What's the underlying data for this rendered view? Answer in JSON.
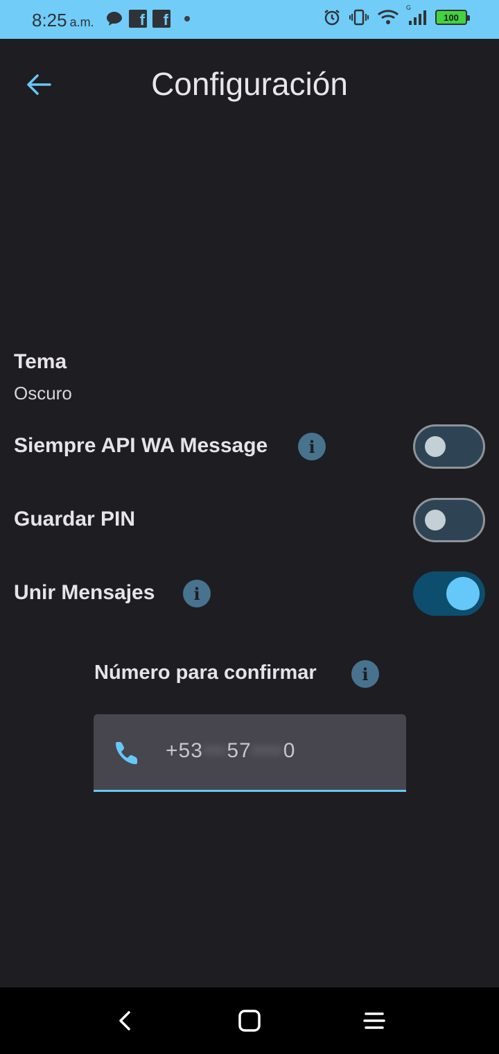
{
  "status_bar": {
    "time": "8:25",
    "ampm": "a.m.",
    "battery": "100",
    "icons_left": [
      "chat-bubble-icon",
      "facebook-icon",
      "facebook-icon",
      "dot"
    ],
    "icons_right": [
      "alarm-icon",
      "vibrate-icon",
      "wifi-icon",
      "signal-icon",
      "battery-icon"
    ],
    "network_letter": "G"
  },
  "appbar": {
    "title": "Configuración"
  },
  "settings": {
    "theme": {
      "label": "Tema",
      "value": "Oscuro"
    },
    "always_api": {
      "label": "Siempre API WA Message",
      "enabled": false
    },
    "save_pin": {
      "label": "Guardar PIN",
      "enabled": false
    },
    "join_messages": {
      "label": "Unir Mensajes",
      "enabled": true
    }
  },
  "confirm": {
    "label": "Número para confirmar",
    "phone_prefix": "+53",
    "phone_visible_mid": "57",
    "phone_last": "0"
  },
  "colors": {
    "status_bar": "#71ccf8",
    "background": "#1e1d22",
    "accent": "#66c8f8",
    "info_icon": "#47738e"
  },
  "info_icon_glyph": "i"
}
